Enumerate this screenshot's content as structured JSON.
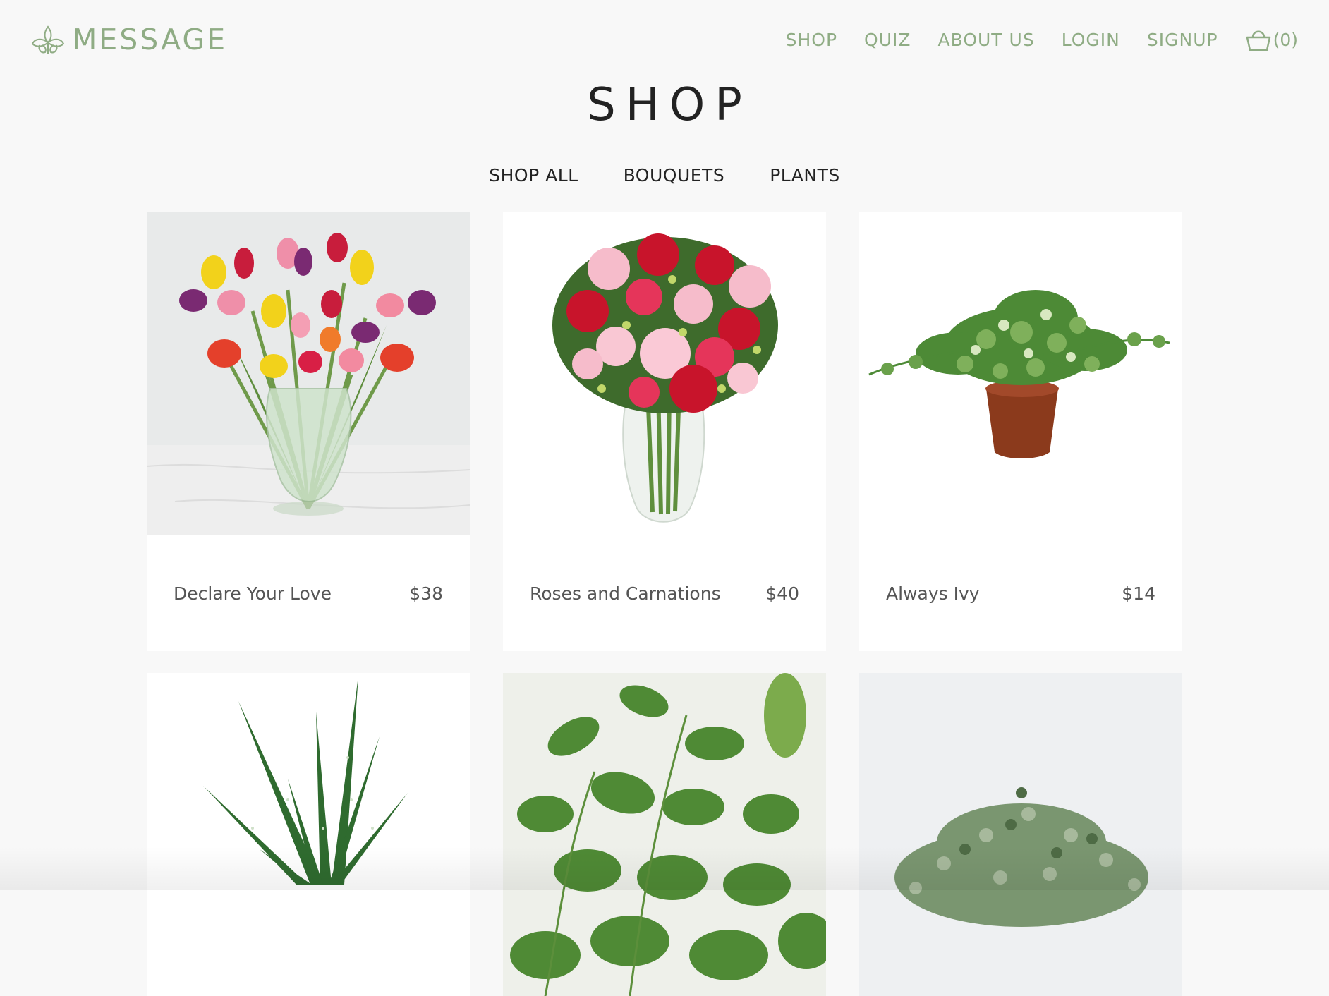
{
  "brand": {
    "name": "MESSAGE",
    "logo_icon": "iris-flower-icon",
    "color": "#8fac84"
  },
  "nav": {
    "links": [
      "SHOP",
      "QUIZ",
      "ABOUT US",
      "LOGIN",
      "SIGNUP"
    ],
    "cart_icon": "shopping-basket-icon",
    "cart_count": "(0)"
  },
  "page": {
    "title": "SHOP"
  },
  "filters": [
    "SHOP ALL",
    "BOUQUETS",
    "PLANTS"
  ],
  "products": [
    {
      "name": "Declare Your Love",
      "price": "$38",
      "image": "tulip-bouquet"
    },
    {
      "name": "Roses and Carnations",
      "price": "$40",
      "image": "rose-carnation-bouquet"
    },
    {
      "name": "Always Ivy",
      "price": "$14",
      "image": "ivy-plant"
    },
    {
      "name": "",
      "price": "",
      "image": "aloe-plant"
    },
    {
      "name": "",
      "price": "",
      "image": "mint-plant"
    },
    {
      "name": "",
      "price": "",
      "image": "herb-plant"
    }
  ]
}
